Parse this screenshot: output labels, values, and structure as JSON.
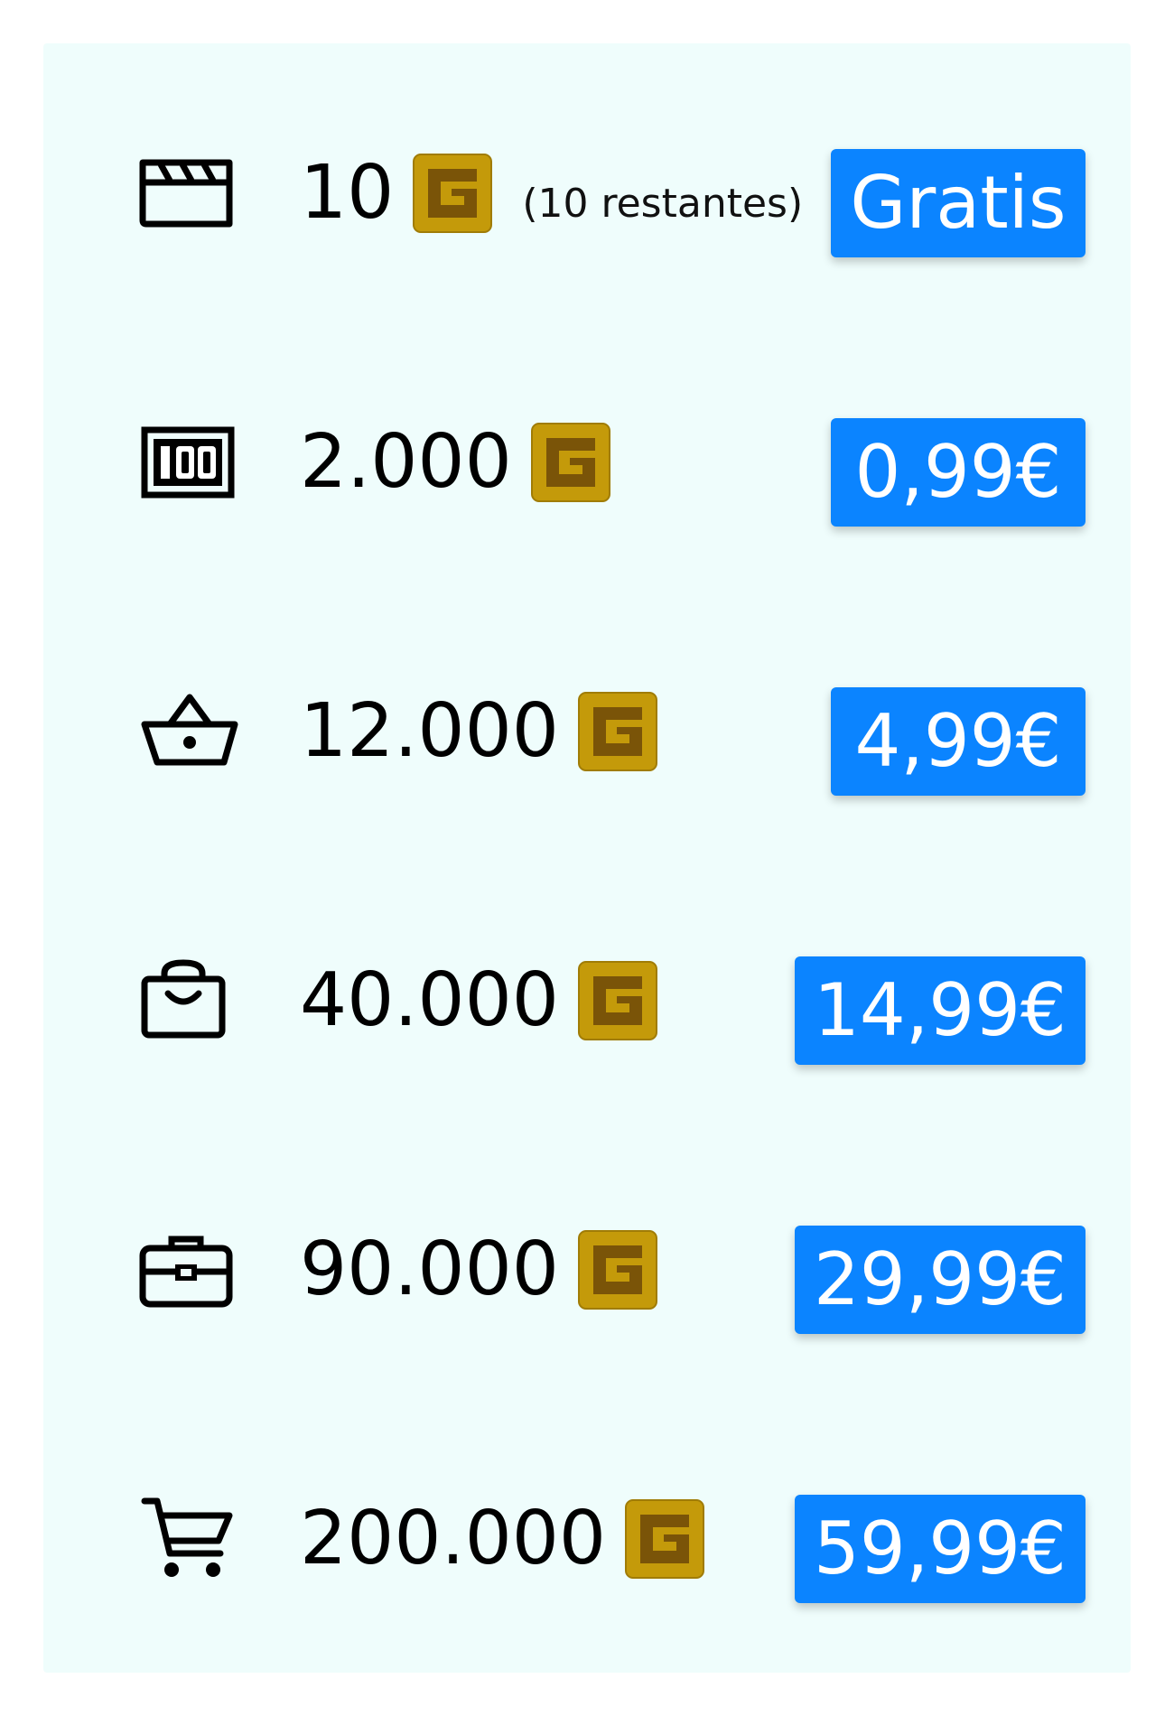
{
  "coin": {
    "icon": "g-coin-icon",
    "colors": {
      "outer": "#c49a0a",
      "inner": "#7a5408"
    }
  },
  "accent_color": "#0b84ff",
  "background_color": "#effdfc",
  "packages": [
    {
      "icon": "clapperboard-icon",
      "amount": "10",
      "note": "(10 restantes)",
      "price": "Gratis"
    },
    {
      "icon": "hundred-box-icon",
      "amount": "2.000",
      "note": "",
      "price": "0,99€"
    },
    {
      "icon": "basket-icon",
      "amount": "12.000",
      "note": "",
      "price": "4,99€"
    },
    {
      "icon": "shopping-bag-icon",
      "amount": "40.000",
      "note": "",
      "price": "14,99€"
    },
    {
      "icon": "briefcase-icon",
      "amount": "90.000",
      "note": "",
      "price": "29,99€"
    },
    {
      "icon": "shopping-cart-icon",
      "amount": "200.000",
      "note": "",
      "price": "59,99€"
    }
  ]
}
